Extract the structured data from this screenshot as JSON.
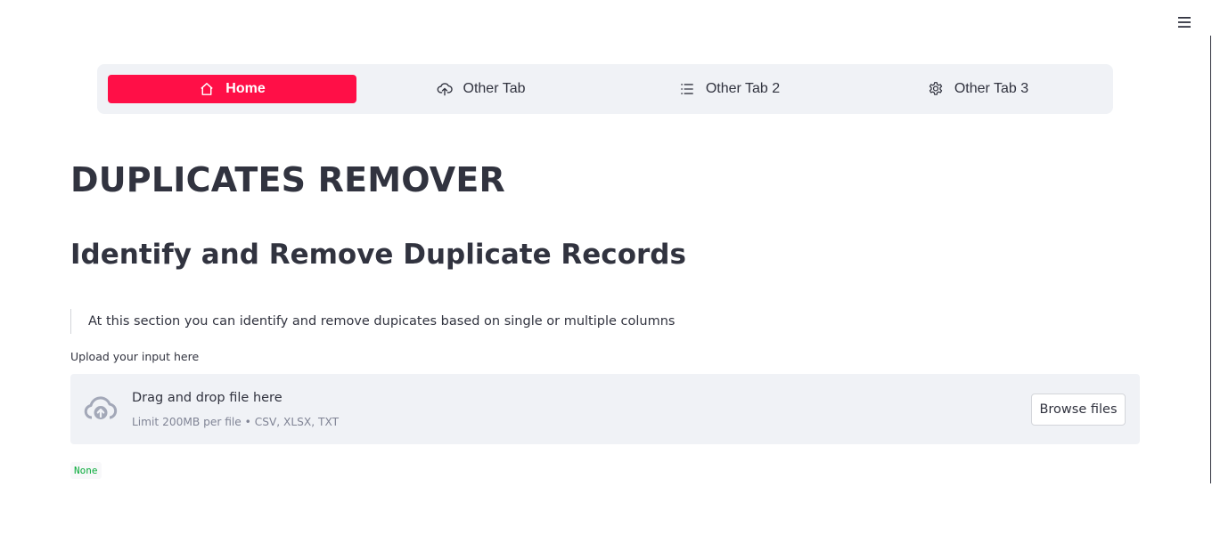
{
  "menu": {
    "icon": "hamburger-menu-icon"
  },
  "nav": {
    "items": [
      {
        "label": "Home",
        "icon": "house-icon",
        "active": true
      },
      {
        "label": "Other Tab",
        "icon": "cloud-upload-icon",
        "active": false
      },
      {
        "label": "Other Tab 2",
        "icon": "list-task-icon",
        "active": false
      },
      {
        "label": "Other Tab 3",
        "icon": "gear-icon",
        "active": false
      }
    ],
    "active_color": "#ff0f47",
    "background_color": "#f0f2f6"
  },
  "main": {
    "title": "DUPLICATES REMOVER",
    "subheader": "Identify and Remove Duplicate Records",
    "description": "At this section you can identify and remove dupicates based on single or multiple columns",
    "upload": {
      "label": "Upload your input here",
      "drop_text": "Drag and drop file here",
      "limit_text": "Limit 200MB per file • CSV, XLSX, TXT",
      "button_label": "Browse files",
      "icon": "cloud-upload-icon"
    },
    "output_value": "None",
    "output_color": "#09ab3b"
  }
}
